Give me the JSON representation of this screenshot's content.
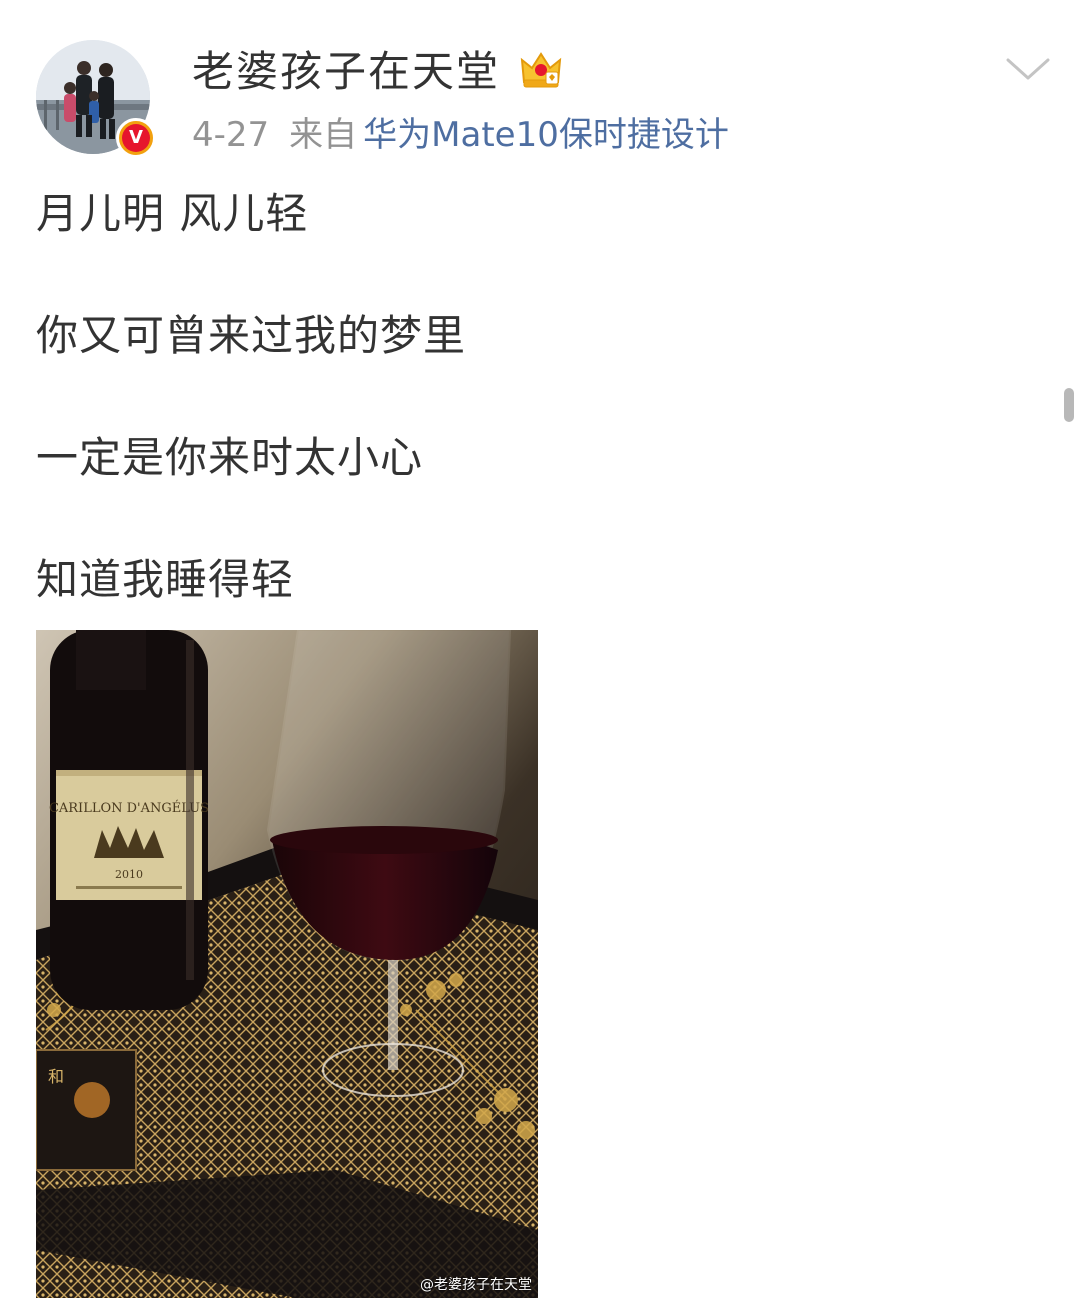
{
  "post": {
    "author": {
      "username": "老婆孩子在天堂",
      "avatar_icon": "user-avatar-photo",
      "verified_icon": "verified-v-badge-icon",
      "verified_letter": "V",
      "member_icon": "crown-member-level-icon"
    },
    "meta": {
      "time": "4-27",
      "from_label": "来自",
      "device": "华为Mate10保时捷设计"
    },
    "menu_icon": "chevron-down-icon",
    "text_lines": [
      "月儿明 风儿轻",
      "你又可曾来过我的梦里",
      "一定是你来时太小心",
      "知道我睡得轻"
    ],
    "image": {
      "description_icon": "wine-bottle-glass-photo",
      "watermark": "@老婆孩子在天堂"
    }
  },
  "colors": {
    "username": "#333333",
    "meta": "#939393",
    "device_link": "#4e6ea1",
    "verified_orange": "#f2a10f",
    "verified_red": "#e6162d"
  }
}
